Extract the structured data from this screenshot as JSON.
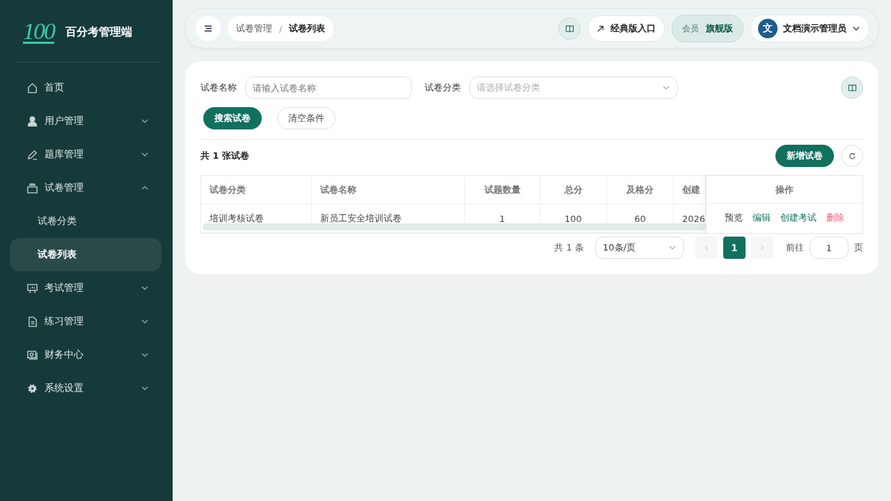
{
  "sidebar": {
    "logo_text": "100",
    "title": "百分考管理端",
    "items": [
      {
        "label": "首页",
        "kind": "home"
      },
      {
        "label": "用户管理",
        "kind": "user",
        "expanded": false
      },
      {
        "label": "题库管理",
        "kind": "pen",
        "expanded": false
      },
      {
        "label": "试卷管理",
        "kind": "tray",
        "expanded": true,
        "children": [
          {
            "label": "试卷分类",
            "selected": false
          },
          {
            "label": "试卷列表",
            "selected": true
          }
        ]
      },
      {
        "label": "考试管理",
        "kind": "board",
        "expanded": false
      },
      {
        "label": "练习管理",
        "kind": "doc",
        "expanded": false
      },
      {
        "label": "财务中心",
        "kind": "money",
        "expanded": false
      },
      {
        "label": "系统设置",
        "kind": "gear",
        "expanded": false
      }
    ]
  },
  "header": {
    "breadcrumb": [
      "试卷管理",
      "试卷列表"
    ],
    "separator": "/",
    "classic_link": "经典版入口",
    "member_label": "会员",
    "member_level": "旗舰版",
    "avatar_letter": "文",
    "user_name": "文档演示管理员"
  },
  "filters": [
    {
      "label": "试卷名称",
      "placeholder": "请输入试卷名称",
      "kind": "input"
    },
    {
      "label": "试卷分类",
      "placeholder": "请选择试卷分类",
      "kind": "select"
    }
  ],
  "search_button": "搜索试卷",
  "clear_button": "清空条件",
  "summary": {
    "prefix": "共",
    "count": "1",
    "suffix": "张试卷"
  },
  "add_button": "新增试卷",
  "table": {
    "columns": [
      "试卷分类",
      "试卷名称",
      "试题数量",
      "总分",
      "及格分",
      "创建"
    ],
    "actions_header": "操作",
    "rows": [
      {
        "cells": [
          "培训考核试卷",
          "新员工安全培训试卷",
          "1",
          "100",
          "60",
          "2026"
        ],
        "actions": [
          {
            "label": "预览",
            "kind": "normal"
          },
          {
            "label": "编辑",
            "kind": "primary"
          },
          {
            "label": "创建考试",
            "kind": "primary"
          },
          {
            "label": "删除",
            "kind": "danger"
          }
        ]
      }
    ]
  },
  "pagination": {
    "total": "共 1 条",
    "page_size": "10条/页",
    "pages": [
      {
        "label": "1",
        "selected": true
      }
    ],
    "goto_label": "前往",
    "goto_value": "1",
    "page_unit": "页"
  }
}
